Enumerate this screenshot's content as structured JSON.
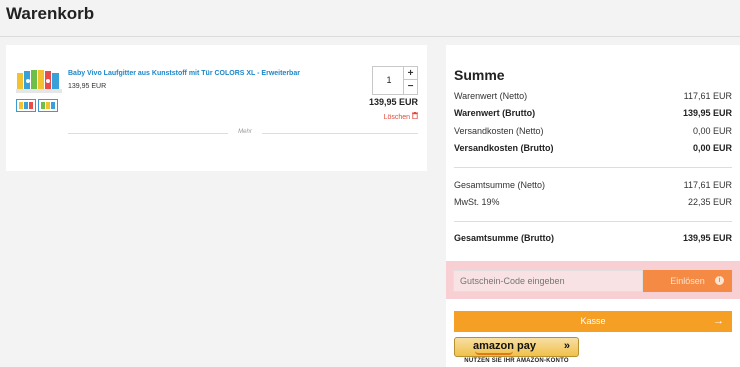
{
  "page": {
    "title": "Warenkorb"
  },
  "cart": {
    "items": [
      {
        "name": "Baby Vivo Laufgitter aus Kunststoff mit Tür COLORS XL - Erweiterbar",
        "unit_price": "139,95 EUR",
        "quantity": "1",
        "plus_icon": "+",
        "minus_icon": "−",
        "total": "139,95 EUR",
        "delete_label": "Löschen",
        "delete_icon": "trash-icon"
      }
    ],
    "more_label": "Mehr"
  },
  "summary": {
    "title": "Summe",
    "rows": [
      {
        "label": "Warenwert (Netto)",
        "value": "117,61 EUR"
      },
      {
        "label": "Warenwert (Brutto)",
        "value": "139,95 EUR"
      },
      {
        "label": "Versandkosten (Netto)",
        "value": "0,00 EUR"
      },
      {
        "label": "Versandkosten (Brutto)",
        "value": "0,00 EUR"
      },
      {
        "label": "Gesamtsumme (Netto)",
        "value": "117,61 EUR"
      },
      {
        "label": "MwSt. 19%",
        "value": "22,35 EUR"
      },
      {
        "label": "Gesamtsumme (Brutto)",
        "value": "139,95 EUR"
      }
    ],
    "coupon": {
      "placeholder": "Gutschein-Code eingeben",
      "button_label": "Einlösen",
      "info_icon": "i"
    },
    "checkout_label": "Kasse",
    "checkout_icon": "→",
    "amazon": {
      "logo_text": "amazon pay",
      "chevron": "»",
      "tagline": "NUTZEN SIE IHR AMAZON-KONTO"
    }
  },
  "colors": {
    "accent_orange": "#f5a025",
    "coupon_orange": "#f58a44",
    "link_blue": "#1c87c9",
    "delete_red": "#e04a3a"
  }
}
